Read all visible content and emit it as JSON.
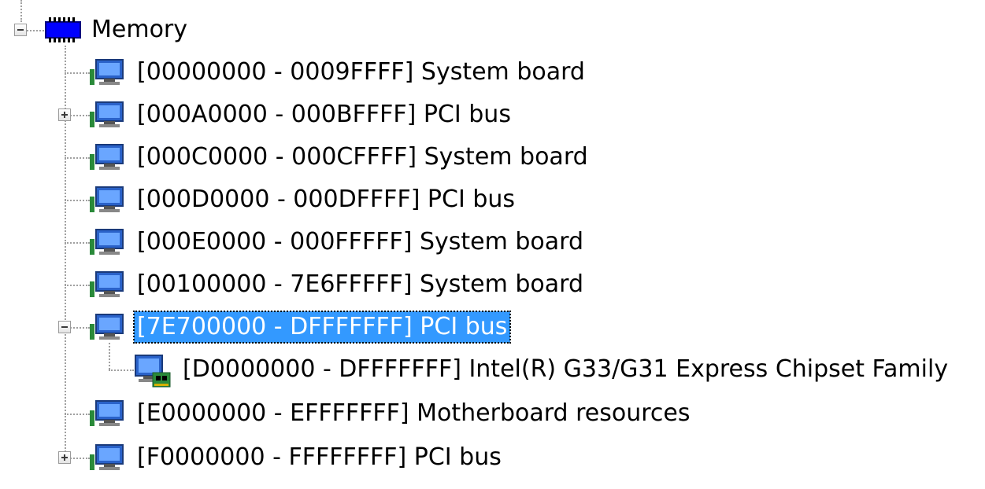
{
  "tree": {
    "root": {
      "label": "Memory",
      "icon": "memory-chip-icon",
      "expanded": true
    },
    "items": [
      {
        "label": "[00000000 - 0009FFFF]  System board",
        "icon": "system-device-icon",
        "expander": "none"
      },
      {
        "label": "[000A0000 - 000BFFFF]  PCI bus",
        "icon": "system-device-icon",
        "expander": "plus"
      },
      {
        "label": "[000C0000 - 000CFFFF]  System board",
        "icon": "system-device-icon",
        "expander": "none"
      },
      {
        "label": "[000D0000 - 000DFFFF]  PCI bus",
        "icon": "system-device-icon",
        "expander": "none"
      },
      {
        "label": "[000E0000 - 000FFFFF]  System board",
        "icon": "system-device-icon",
        "expander": "none"
      },
      {
        "label": "[00100000 - 7E6FFFFF]  System board",
        "icon": "system-device-icon",
        "expander": "none"
      },
      {
        "label": "[7E700000 - DFFFFFFF]  PCI bus",
        "icon": "system-device-icon",
        "expander": "minus",
        "selected": true,
        "children": [
          {
            "label": "[D0000000 - DFFFFFFF]  Intel(R) G33/G31 Express Chipset Family",
            "icon": "display-adapter-icon"
          }
        ]
      },
      {
        "label": "[E0000000 - EFFFFFFF]  Motherboard resources",
        "icon": "system-device-icon",
        "expander": "none"
      },
      {
        "label": "[F0000000 - FFFFFFFF]  PCI bus",
        "icon": "system-device-icon",
        "expander": "plus"
      }
    ]
  },
  "colors": {
    "selection_background": "#3399ff",
    "selection_text": "#ffffff",
    "tree_lines": "#a0a0a0"
  }
}
